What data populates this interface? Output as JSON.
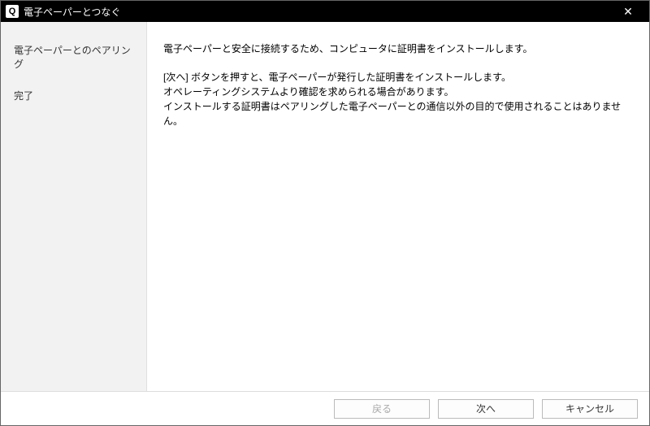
{
  "titlebar": {
    "icon_letter": "Q",
    "title": "電子ペーパーとつなぐ"
  },
  "sidebar": {
    "items": [
      {
        "label": "電子ペーパーとのペアリング"
      },
      {
        "label": "完了"
      }
    ]
  },
  "main": {
    "p1": "電子ペーパーと安全に接続するため、コンピュータに証明書をインストールします。",
    "p2_line1": "[次へ] ボタンを押すと、電子ペーパーが発行した証明書をインストールします。",
    "p2_line2": "オペレーティングシステムより確認を求められる場合があります。",
    "p2_line3": "インストールする証明書はペアリングした電子ペーパーとの通信以外の目的で使用されることはありません。"
  },
  "footer": {
    "back": "戻る",
    "next": "次へ",
    "cancel": "キャンセル"
  }
}
